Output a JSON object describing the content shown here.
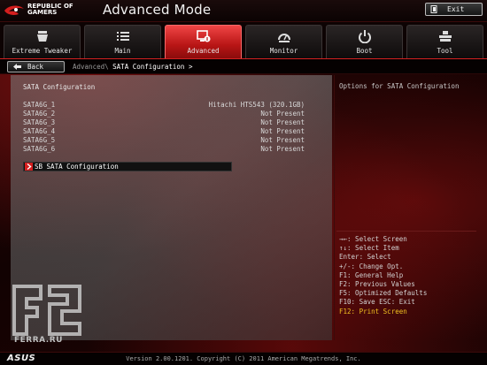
{
  "header": {
    "logo_line1": "REPUBLIC OF",
    "logo_line2": "GAMERS",
    "mode_title": "Advanced Mode",
    "exit_label": "Exit"
  },
  "tabs": [
    {
      "label": "Extreme Tweaker",
      "icon": "extreme-tweaker-icon",
      "active": false
    },
    {
      "label": "Main",
      "icon": "list-icon",
      "active": false
    },
    {
      "label": "Advanced",
      "icon": "advanced-chip-icon",
      "active": true
    },
    {
      "label": "Monitor",
      "icon": "monitor-gauge-icon",
      "active": false
    },
    {
      "label": "Boot",
      "icon": "power-icon",
      "active": false
    },
    {
      "label": "Tool",
      "icon": "tool-icon",
      "active": false
    }
  ],
  "nav": {
    "back_label": "Back",
    "breadcrumb_parent": "Advanced\\",
    "breadcrumb_current": "SATA Configuration >"
  },
  "main": {
    "section_title": "SATA Configuration",
    "sata_ports": [
      {
        "name": "SATA6G_1",
        "value": "Hitachi HTS543 (320.1GB)"
      },
      {
        "name": "SATA6G_2",
        "value": "Not Present"
      },
      {
        "name": "SATA6G_3",
        "value": "Not Present"
      },
      {
        "name": "SATA6G_4",
        "value": "Not Present"
      },
      {
        "name": "SATA6G_5",
        "value": "Not Present"
      },
      {
        "name": "SATA6G_6",
        "value": "Not Present"
      }
    ],
    "submenu_label": "SB SATA Configuration"
  },
  "help": {
    "title": "Options for  SATA Configuration",
    "shortcuts": [
      "→←: Select Screen",
      "↑↓: Select Item",
      "Enter: Select",
      "+/-: Change Opt.",
      "F1: General Help",
      "F2: Previous Values",
      "F5: Optimized Defaults",
      "F10: Save  ESC: Exit",
      "F12: Print Screen"
    ],
    "highlight_color": "#f0c020"
  },
  "watermark": {
    "text": "FERRA.RU"
  },
  "footer": {
    "brand": "ASUS",
    "version": "Version 2.00.1201. Copyright (C) 2011 American Megatrends, Inc."
  },
  "colors": {
    "accent_red": "#d41e1e",
    "active_tab": "#e03030"
  }
}
